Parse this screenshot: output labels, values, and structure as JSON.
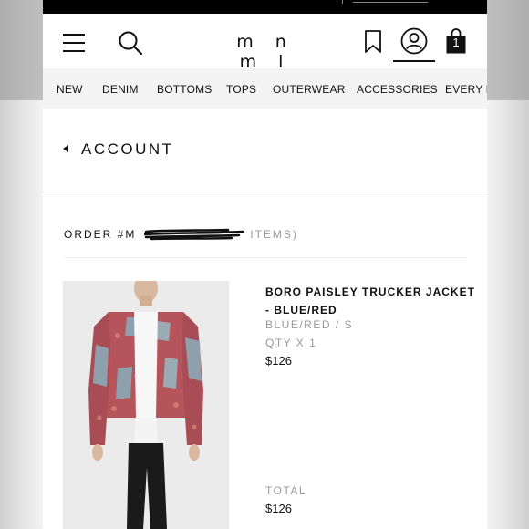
{
  "header": {
    "logo": "m n m l",
    "bag_count": "1"
  },
  "nav": {
    "items": [
      "NEW",
      "DENIM",
      "BOTTOMS",
      "TOPS",
      "OUTERWEAR",
      "ACCESSORIES",
      "EVERY D"
    ]
  },
  "account": {
    "title": "ACCOUNT"
  },
  "order": {
    "label": "ORDER #M",
    "items_suffix": "ITEMS)"
  },
  "product": {
    "name": "BORO PAISLEY TRUCKER JACKET - BLUE/RED",
    "variant": "BLUE/RED / S",
    "qty": "QTY X 1",
    "price": "$126"
  },
  "total": {
    "label": "TOTAL",
    "value": "$126"
  },
  "colors": {
    "header_bg": "#ffffff",
    "nav_bg": "#f4f4f4",
    "text": "#111111",
    "muted_text": "#999999",
    "statusbar": "#000000",
    "jacket_red": "#b5545a",
    "jacket_denim": "#8fa0ad"
  }
}
